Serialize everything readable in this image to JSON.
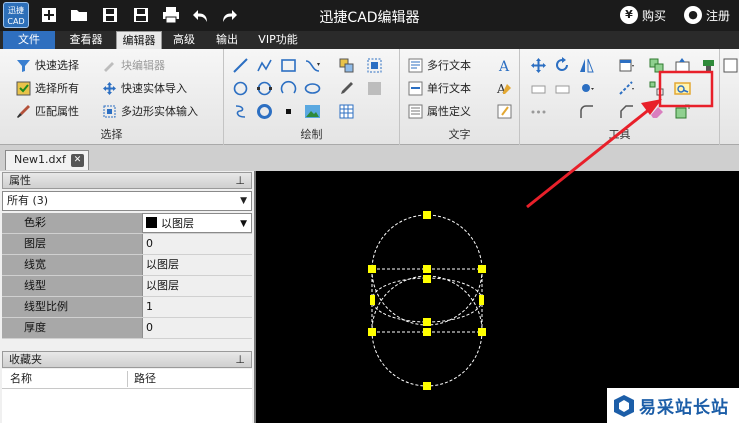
{
  "titlebar": {
    "logo_text": "迅捷 CAD",
    "title": "迅捷CAD编辑器",
    "buy_label": "购买",
    "register_label": "注册"
  },
  "menu": {
    "tabs": [
      {
        "label": "文件"
      },
      {
        "label": "查看器"
      },
      {
        "label": "编辑器"
      },
      {
        "label": "高级"
      },
      {
        "label": "输出"
      },
      {
        "label": "VIP功能"
      }
    ],
    "active": "编辑器"
  },
  "ribbon": {
    "select_group": {
      "label": "选择",
      "quick_select": "快速选择",
      "select_all": "选择所有",
      "match_props": "匹配属性",
      "block_editor": "块编辑器",
      "quick_entity_import": "快速实体导入",
      "polygon_entity_input": "多边形实体输入"
    },
    "draw_group": {
      "label": "绘制"
    },
    "text_group": {
      "label": "文字",
      "multiline_text": "多行文本",
      "single_text": "单行文本",
      "attr_define": "属性定义"
    },
    "tools_group": {
      "label": "工具"
    }
  },
  "document": {
    "tab_label": "New1.dxf",
    "close_glyph": "✕"
  },
  "properties": {
    "header": "属性",
    "pin": "𝌆",
    "selection": "所有 (3)",
    "rows": [
      {
        "name": "色彩",
        "value": "以图层"
      },
      {
        "name": "图层",
        "value": "0"
      },
      {
        "name": "线宽",
        "value": "以图层"
      },
      {
        "name": "线型",
        "value": "以图层"
      },
      {
        "name": "线型比例",
        "value": "1"
      },
      {
        "name": "厚度",
        "value": "0"
      }
    ]
  },
  "favorites": {
    "header": "收藏夹",
    "col_name": "名称",
    "col_path": "路径"
  },
  "watermark": {
    "text": "易采站长站"
  },
  "colors": {
    "titlebar": "#1b1b1b",
    "file_tab": "#2f6fbf",
    "grip": "#ffff00",
    "highlight": "#e8202a"
  }
}
